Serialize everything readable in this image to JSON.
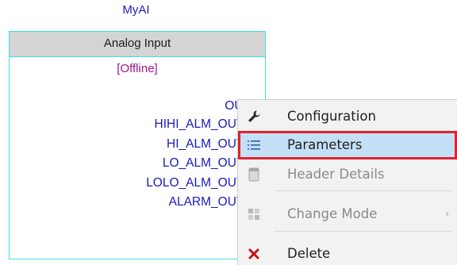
{
  "block": {
    "name": "MyAI",
    "type_label": "Analog Input",
    "status": "[Offline]",
    "outputs": [
      "OUT",
      "HIHI_ALM_OUT_",
      "HI_ALM_OUT_",
      "LO_ALM_OUT_",
      "LOLO_ALM_OUT_",
      "ALARM_OUT_"
    ]
  },
  "context_menu": {
    "items": [
      {
        "label": "Configuration",
        "icon": "wrench-icon",
        "state": "enabled"
      },
      {
        "label": "Parameters",
        "icon": "list-icon",
        "state": "highlighted"
      },
      {
        "label": "Header Details",
        "icon": "header-icon",
        "state": "disabled"
      },
      {
        "label": "Change Mode",
        "icon": "grid-icon",
        "state": "disabled",
        "has_submenu": true,
        "submenu_arrow": "›"
      },
      {
        "label": "Delete",
        "icon": "delete-x-icon",
        "state": "enabled"
      }
    ]
  },
  "colors": {
    "block_border": "#3ee0e8",
    "header_bg": "#d4d4d4",
    "output_text": "#1a1ab8",
    "status_text": "#a0168c",
    "menu_bg": "#f2f2f2",
    "highlight_bg": "#c4e0f7",
    "highlight_border": "#e0232b",
    "delete_icon": "#c0141e"
  }
}
